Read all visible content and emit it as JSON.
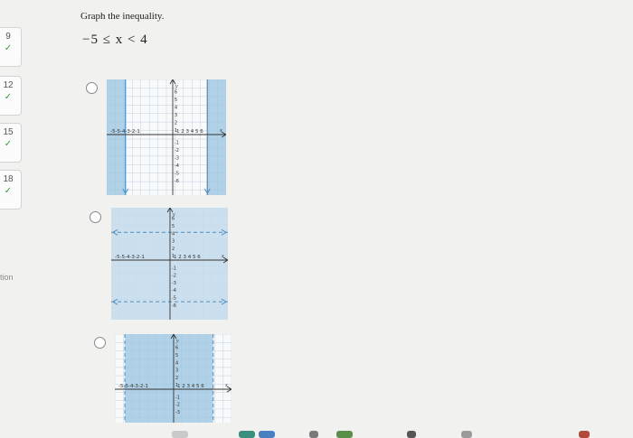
{
  "sidebar": {
    "items": [
      {
        "number": "9",
        "status": "correct"
      },
      {
        "number": "12",
        "status": "correct"
      },
      {
        "number": "15",
        "status": "correct"
      },
      {
        "number": "18",
        "status": "correct"
      }
    ],
    "check_glyph": "✓",
    "partial_label": "tion"
  },
  "question": {
    "instruction": "Graph the inequality.",
    "inequality": "−5 ≤ x < 4"
  },
  "options": [
    {
      "id": "A",
      "selected": false,
      "shading": "vertical-outside",
      "y_label": "y",
      "x_label": "x",
      "x_ticks_left": "-5-5-4-3-2-1",
      "x_ticks_right": "1 2 3 4 5 6",
      "y_ticks_up": [
        "6",
        "5",
        "4",
        "3",
        "2",
        "1"
      ],
      "y_ticks_down": [
        "-1",
        "-2",
        "-3",
        "-4",
        "-5",
        "-6"
      ]
    },
    {
      "id": "B",
      "selected": false,
      "shading": "horizontal-band",
      "y_label": "y",
      "x_label": "x",
      "x_ticks_left": "-5-5-4-3-2-1",
      "x_ticks_right": "1 2 3 4 5 6",
      "y_ticks_up": [
        "6",
        "5",
        "4",
        "3",
        "2",
        "1"
      ],
      "y_ticks_down": [
        "-1",
        "-2",
        "-3",
        "-4",
        "-5",
        "-6"
      ]
    },
    {
      "id": "C",
      "selected": false,
      "shading": "vertical-band",
      "y_label": "y",
      "x_label": "x",
      "x_ticks_left": "-5-5-4-3-2-1",
      "x_ticks_right": "1 2 3 4 5 6",
      "y_ticks_up": [
        "6",
        "5",
        "4",
        "3",
        "2",
        "1"
      ],
      "y_ticks_down": [
        "-1",
        "-2",
        "-3"
      ]
    }
  ],
  "colors": {
    "shade": "#9ec7e2",
    "shade_light": "#c6dcec",
    "boundary": "#4f8fc0",
    "grid": "#c2d2dd",
    "check": "#3a9c3a"
  }
}
